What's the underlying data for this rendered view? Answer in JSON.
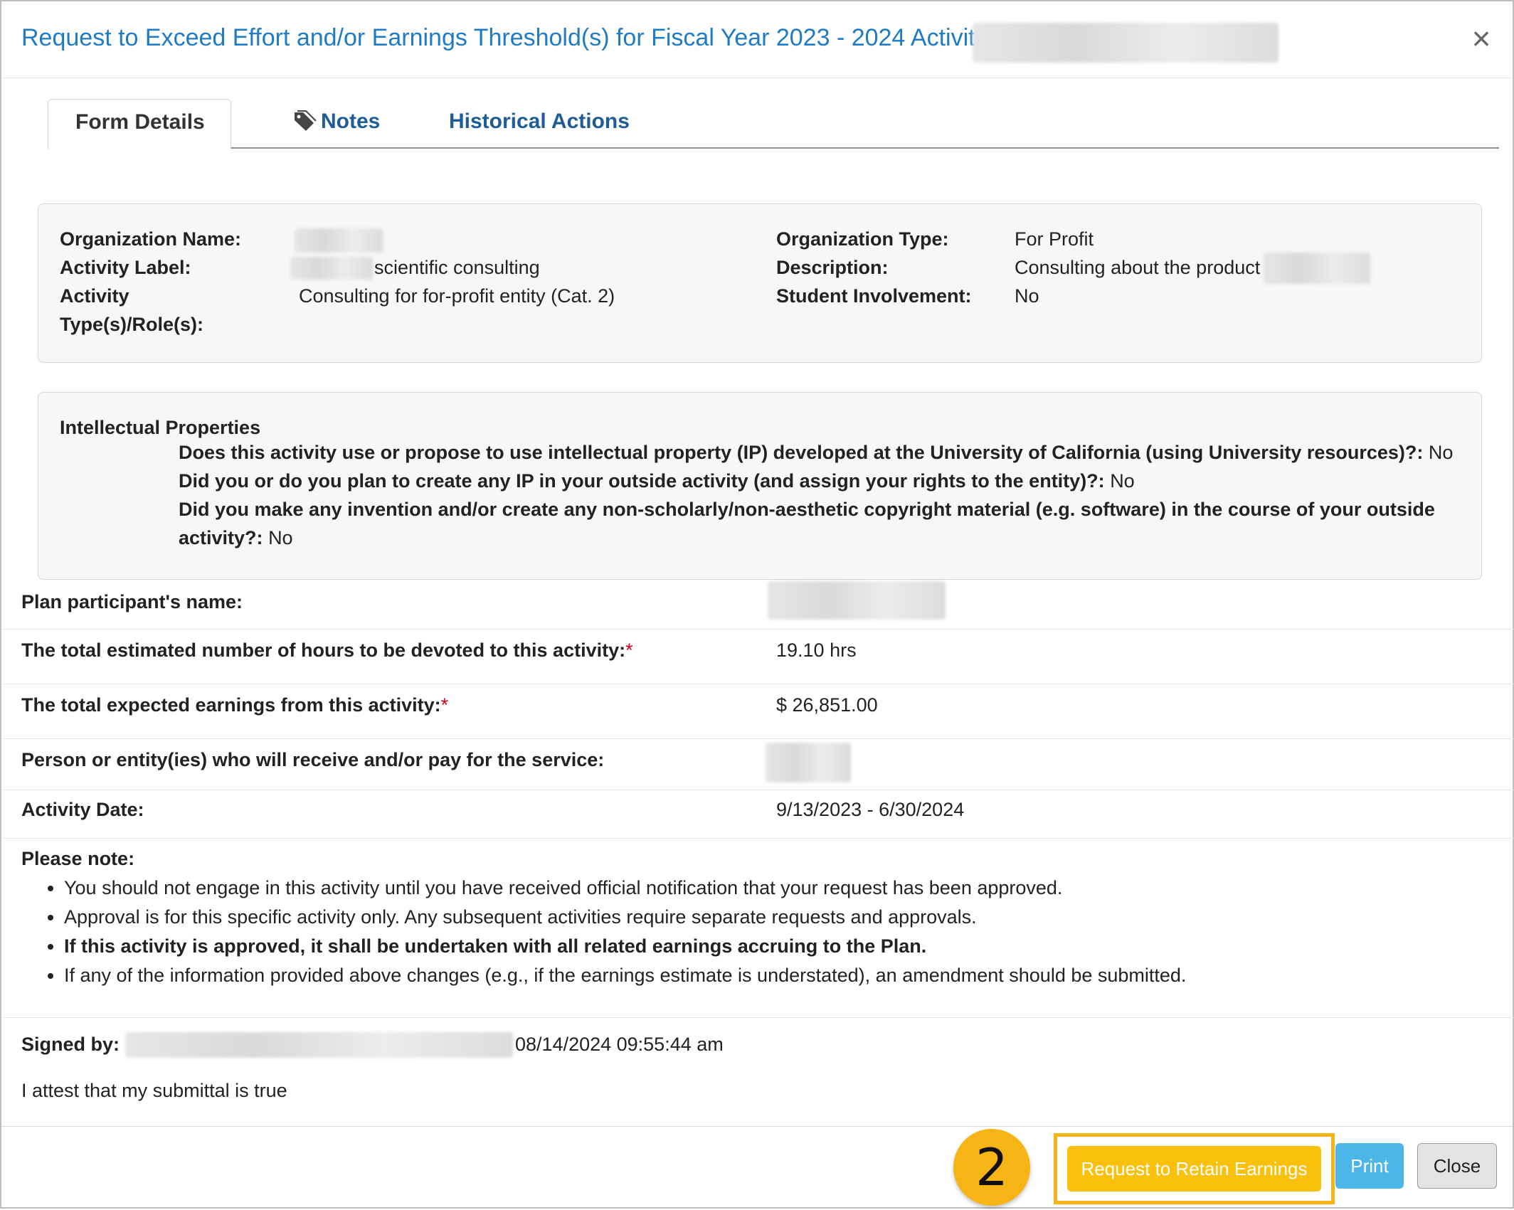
{
  "header": {
    "title": "Request to Exceed Effort and/or Earnings Threshold(s) for Fiscal Year 2023 - 2024 Activity:",
    "close_glyph": "×"
  },
  "tabs": [
    {
      "label": "Form Details",
      "icon": ""
    },
    {
      "label": "Notes",
      "icon": "tag-icon"
    },
    {
      "label": "Historical Actions",
      "icon": ""
    }
  ],
  "org_info": {
    "org_name_label": "Organization Name:",
    "activity_label_label": "Activity Label:",
    "activity_label_value": "scientific consulting",
    "activity_type_label_line1": "Activity",
    "activity_type_label_line2": "Type(s)/Role(s):",
    "activity_type_value": "Consulting for for-profit entity (Cat. 2)",
    "org_type_label": "Organization Type:",
    "org_type_value": "For Profit",
    "description_label": "Description:",
    "description_value": "Consulting about the product",
    "student_label": "Student Involvement:",
    "student_value": "No"
  },
  "ip": {
    "title": "Intellectual Properties",
    "q1": "Does this activity use or propose to use intellectual property (IP) developed at the University of California (using University resources)?:",
    "a1": "No",
    "q2": "Did you or do you plan to create any IP in your outside activity (and assign your rights to the entity)?:",
    "a2": "No",
    "q3": "Did you make any invention and/or create any non-scholarly/non-aesthetic copyright material (e.g. software) in the course of your outside activity?:",
    "a3": "No"
  },
  "details": {
    "participant_label": "Plan participant's name:",
    "hours_label": "The total estimated number of hours to be devoted to this activity:",
    "hours_value": "19.10 hrs",
    "earnings_label": "The total expected earnings from this activity:",
    "earnings_value": "$ 26,851.00",
    "payer_label": "Person or entity(ies) who will receive and/or pay for the service:",
    "date_label": "Activity Date:",
    "date_value": "9/13/2023 - 6/30/2024",
    "required_mark": "*"
  },
  "notes": {
    "title": "Please note:",
    "items": [
      "You should not engage in this activity until you have received official notification that your request has been approved.",
      "Approval is for this specific activity only. Any subsequent activities require separate requests and approvals.",
      "If this activity is approved, it shall be undertaken with all related earnings accruing to the Plan.",
      "If any of the information provided above changes (e.g., if the earnings estimate is understated), an amendment should be submitted."
    ]
  },
  "signature": {
    "label": "Signed by:",
    "timestamp": "08/14/2024 09:55:44 am",
    "attest": "I attest that my submittal is true"
  },
  "footer": {
    "step_number": "2",
    "retain_label": "Request to Retain Earnings",
    "print_label": "Print",
    "close_label": "Close",
    "highlight_color": "#f6b514"
  }
}
